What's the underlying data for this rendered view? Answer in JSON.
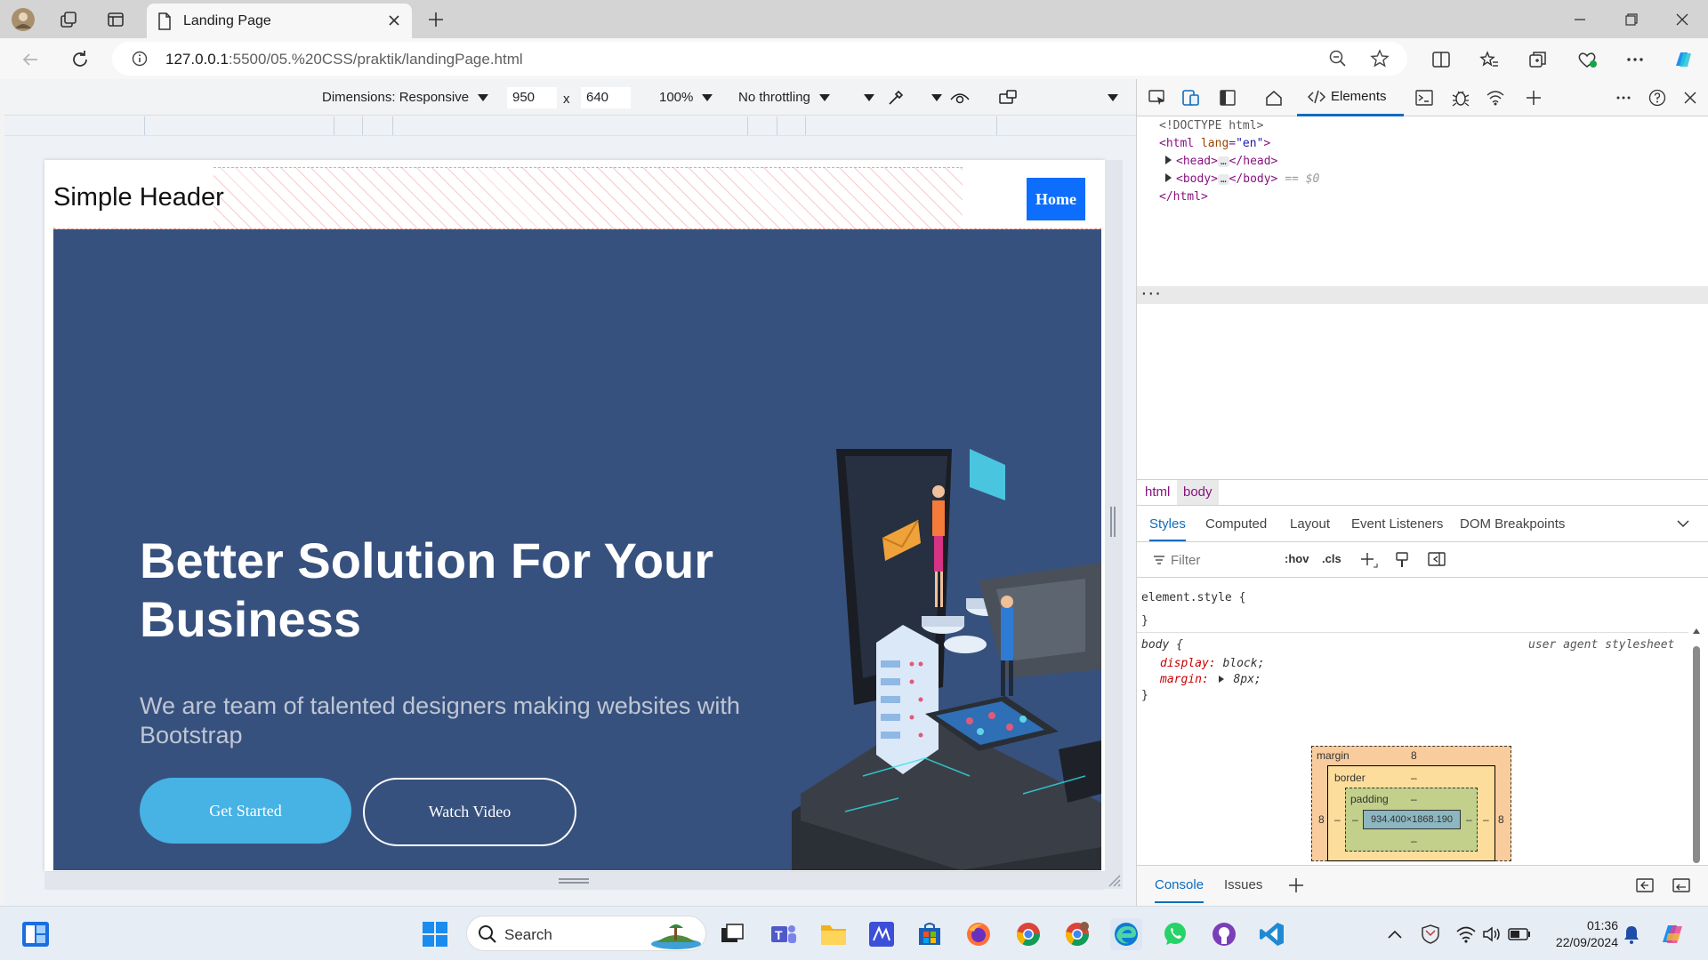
{
  "browser": {
    "tab_title": "Landing Page",
    "url_host": "127.0.0.1",
    "url_path": ":5500/05.%20CSS/praktik/landingPage.html"
  },
  "device_toolbar": {
    "dimensions_label": "Dimensions: Responsive",
    "width": "950",
    "height": "640",
    "times": "x",
    "zoom": "100%",
    "throttling": "No throttling"
  },
  "page": {
    "header_title": "Simple Header",
    "home_button": "Home",
    "hero_heading": "Better Solution For Your Business",
    "hero_subtitle": "We are team of talented designers making websites with Bootstrap",
    "get_started": "Get Started",
    "watch_video": "Watch Video",
    "colors": {
      "hero_bg": "#37517e",
      "home_btn": "#0d6efd",
      "cta": "#47b2e4"
    }
  },
  "devtools": {
    "elements_tab": "Elements",
    "dom": {
      "doctype": "<!DOCTYPE html>",
      "html_open_tag": "<html",
      "html_attr": "lang",
      "html_attr_val": "\"en\"",
      "gt": ">",
      "head_open": "<head>",
      "head_close": "</head>",
      "body_open": "<body>",
      "body_close": "</body>",
      "body_marker": "== $0",
      "html_close": "</html>",
      "ellipsis": "…"
    },
    "breadcrumbs": [
      "html",
      "body"
    ],
    "styles_tabs": [
      "Styles",
      "Computed",
      "Layout",
      "Event Listeners",
      "DOM Breakpoints"
    ],
    "filter_placeholder": "Filter",
    "hov": ":hov",
    "cls": ".cls",
    "rules": {
      "element_style": "element.style {",
      "close_brace": "}",
      "body_selector": "body {",
      "ua_label": "user agent stylesheet",
      "display_prop": "display:",
      "display_val": "block;",
      "margin_prop": "margin:",
      "margin_val": "8px;"
    },
    "box_model": {
      "margin_label": "margin",
      "margin_val": "8",
      "border_label": "border",
      "padding_label": "padding",
      "dash": "–",
      "content_size": "934.400×1868.190",
      "side_val": "8"
    },
    "drawer_tabs": [
      "Console",
      "Issues"
    ]
  },
  "taskbar": {
    "search": "Search",
    "time": "01:36",
    "date": "22/09/2024"
  }
}
